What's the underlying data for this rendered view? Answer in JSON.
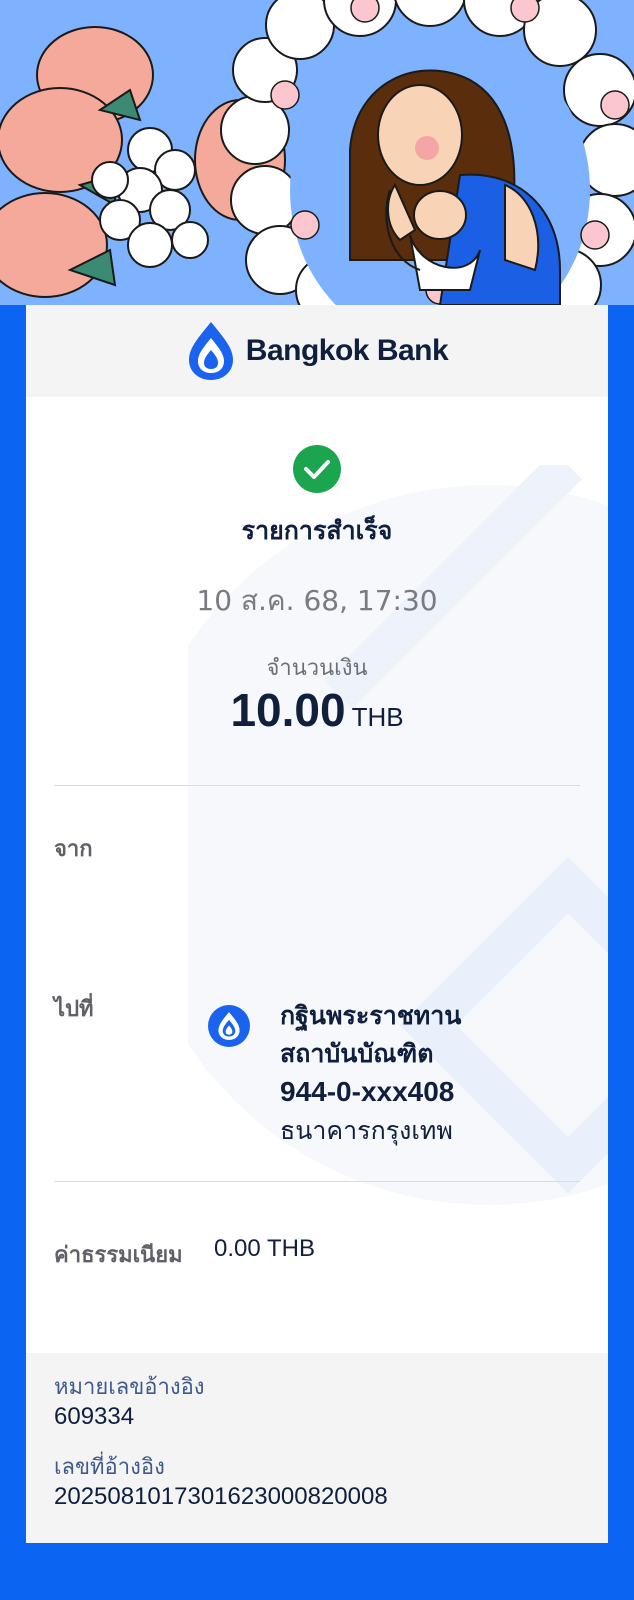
{
  "header": {
    "brand_name": "Bangkok Bank"
  },
  "transaction": {
    "status": "รายการสำเร็จ",
    "datetime": "10 ส.ค. 68, 17:30",
    "amount_label": "จำนวนเงิน",
    "amount": "10.00",
    "currency": "THB"
  },
  "from": {
    "label": "จาก"
  },
  "to": {
    "label": "ไปที่",
    "name_line1": "กฐินพระราชทาน",
    "name_line2": "สถาบันบัณฑิต",
    "account": "944-0-xxx408",
    "bank": "ธนาคารกรุงเทพ",
    "icon": "bangkok-bank-lotus-icon"
  },
  "fee": {
    "label": "ค่าธรรมเนียม",
    "value": "0.00 THB"
  },
  "reference": {
    "ref1_label": "หมายเลขอ้างอิง",
    "ref1_value": "609334",
    "ref2_label": "เลขที่อ้างอิง",
    "ref2_value": "2025081017301623000820008"
  },
  "colors": {
    "page_background": "#0c64f2",
    "hero_background": "#7eb2ff",
    "success_green": "#1ba54f",
    "brand_blue": "#1a63ee",
    "text_dark": "#0f1f3d"
  }
}
